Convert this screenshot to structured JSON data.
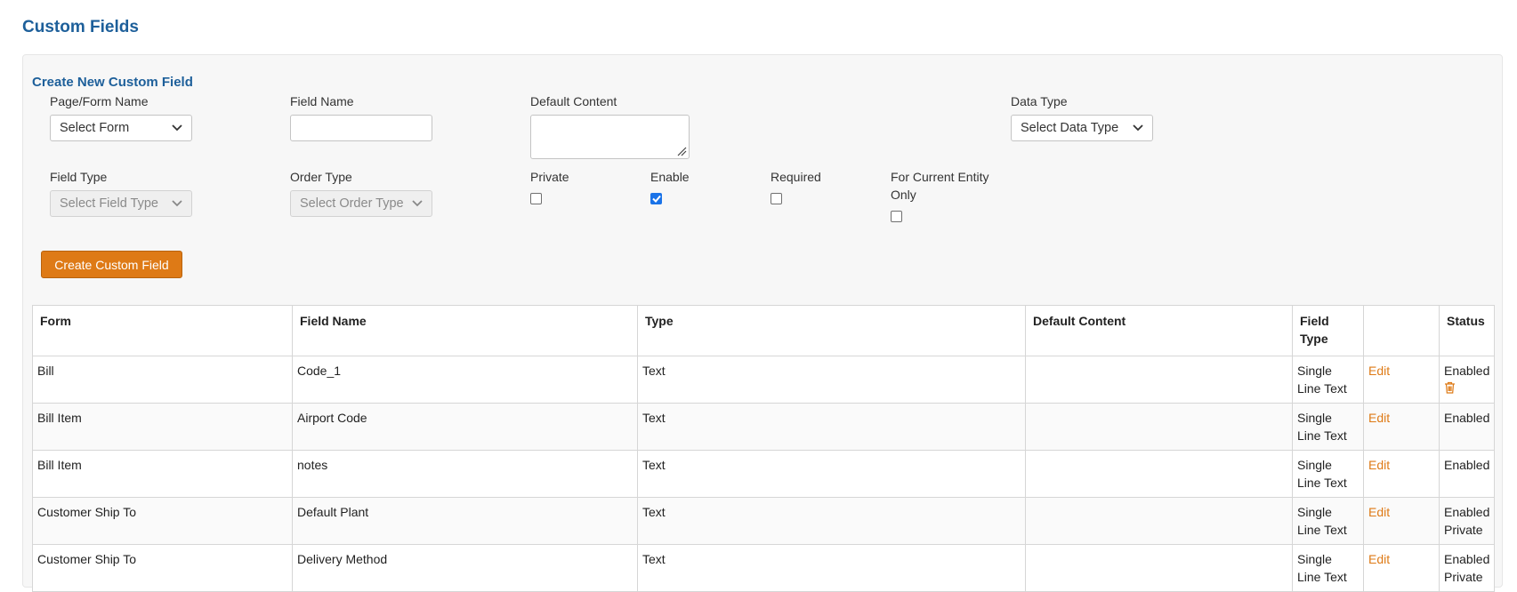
{
  "page": {
    "title": "Custom Fields"
  },
  "form": {
    "section_title": "Create New Custom Field",
    "page_form_name": {
      "label": "Page/Form Name",
      "value": "Select Form"
    },
    "field_name": {
      "label": "Field Name",
      "value": ""
    },
    "default_content": {
      "label": "Default Content",
      "value": ""
    },
    "data_type": {
      "label": "Data Type",
      "value": "Select Data Type"
    },
    "field_type": {
      "label": "Field Type",
      "value": "Select Field Type"
    },
    "order_type": {
      "label": "Order Type",
      "value": "Select Order Type"
    },
    "private": {
      "label": "Private",
      "checked": false
    },
    "enable": {
      "label": "Enable",
      "checked": true
    },
    "required": {
      "label": "Required",
      "checked": false
    },
    "current_entity": {
      "label": "For Current Entity Only",
      "checked": false
    },
    "create_button": "Create Custom Field"
  },
  "table": {
    "columns": [
      "Form",
      "Field Name",
      "Type",
      "Default Content",
      "Field Type",
      "",
      "Status"
    ],
    "rows": [
      {
        "form": "Bill",
        "field_name": "Code_1",
        "type": "Text",
        "default_content": "",
        "field_type": "Single Line Text",
        "action": "Edit",
        "status": "Enabled",
        "status2": ""
      },
      {
        "form": "Bill Item",
        "field_name": "Airport Code",
        "type": "Text",
        "default_content": "",
        "field_type": "Single Line Text",
        "action": "Edit",
        "status": "Enabled",
        "status2": ""
      },
      {
        "form": "Bill Item",
        "field_name": "notes",
        "type": "Text",
        "default_content": "",
        "field_type": "Single Line Text",
        "action": "Edit",
        "status": "Enabled",
        "status2": ""
      },
      {
        "form": "Customer Ship To",
        "field_name": "Default Plant",
        "type": "Text",
        "default_content": "",
        "field_type": "Single Line Text",
        "action": "Edit",
        "status": "Enabled",
        "status2": "Private"
      },
      {
        "form": "Customer Ship To",
        "field_name": "Delivery Method",
        "type": "Text",
        "default_content": "",
        "field_type": "Single Line Text",
        "action": "Edit",
        "status": "Enabled",
        "status2": "Private"
      }
    ]
  },
  "colors": {
    "title": "#1d5f9a",
    "accent": "#de7a16",
    "checkbox": "#1a73e8"
  },
  "icons": {
    "select_arrow": "chevron-down-icon",
    "delete": "trash-icon",
    "check": "check-icon"
  }
}
